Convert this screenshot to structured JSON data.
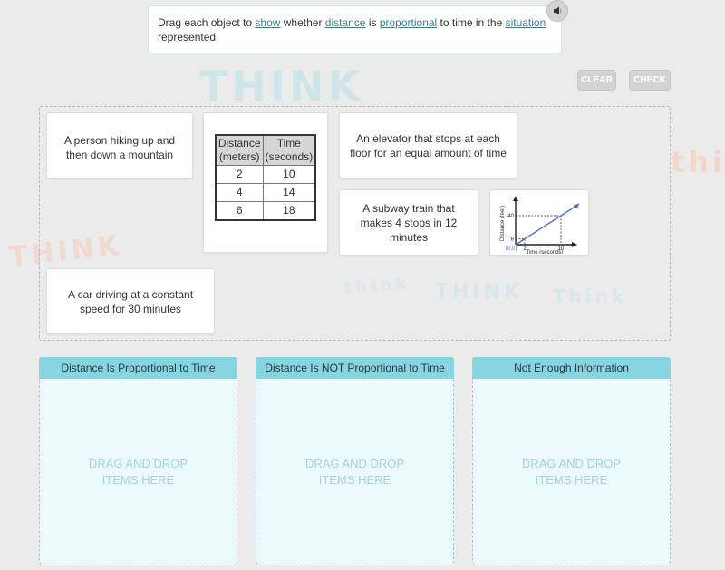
{
  "prompt": {
    "parts": [
      {
        "text": "Drag each object to ",
        "link": false
      },
      {
        "text": "show",
        "link": true
      },
      {
        "text": " whether ",
        "link": false
      },
      {
        "text": "distance",
        "link": true
      },
      {
        "text": " is ",
        "link": false
      },
      {
        "text": "proportional",
        "link": true
      },
      {
        "text": " to time in the ",
        "link": false
      },
      {
        "text": "situation",
        "link": true
      },
      {
        "text": " represented.",
        "link": false
      }
    ],
    "audio_icon": "speaker-icon"
  },
  "toolbar": {
    "clear_label": "CLEAR",
    "check_label": "CHECK"
  },
  "background": {
    "doodle_words": [
      "THINK",
      "THINK",
      "think",
      "THINK",
      "Think",
      "think"
    ],
    "accent_color": "#a9d8dc",
    "accent_color_2": "#efc9b8"
  },
  "tiles": {
    "hiking": "A person hiking up and then down a mountain",
    "elevator": "An elevator that stops at each floor for an equal amount of time",
    "subway": "A subway train that makes 4 stops in 12 minutes",
    "car": "A car driving at a constant speed for 30 minutes",
    "table": {
      "headers": [
        [
          "Distance",
          "(meters)"
        ],
        [
          "Time",
          "(seconds)"
        ]
      ],
      "rows": [
        [
          "2",
          "10"
        ],
        [
          "4",
          "14"
        ],
        [
          "6",
          "18"
        ]
      ]
    },
    "graph": {
      "ylabel": "Distance (feet)",
      "xlabel": "Time (seconds)",
      "origin_label": "(0,0)",
      "y_ticks": [
        "8",
        "40"
      ],
      "x_ticks": [
        "2",
        "10"
      ],
      "points": [
        [
          0,
          0
        ],
        [
          2,
          8
        ],
        [
          10,
          40
        ]
      ],
      "line_color": "#4a72c8"
    }
  },
  "bins": [
    {
      "title": "Distance Is Proportional to Time",
      "placeholder": "DRAG AND DROP ITEMS HERE"
    },
    {
      "title": "Distance Is NOT Proportional to Time",
      "placeholder": "DRAG AND DROP ITEMS HERE"
    },
    {
      "title": "Not Enough Information",
      "placeholder": "DRAG AND DROP ITEMS HERE"
    }
  ],
  "colors": {
    "bin_header": "#86d5e0",
    "bin_body": "#ecf9fb",
    "link": "#3d7e8a",
    "button_bg": "#d3d3d3"
  }
}
